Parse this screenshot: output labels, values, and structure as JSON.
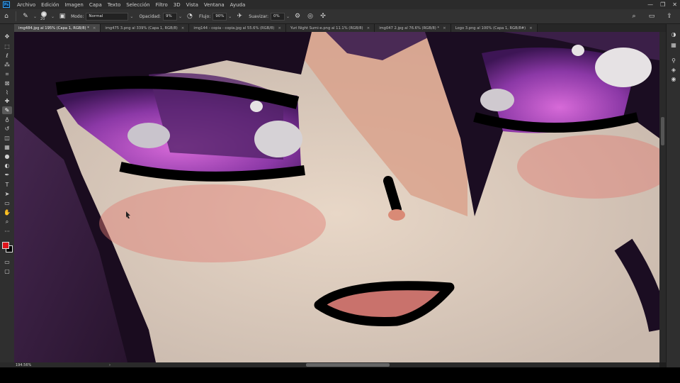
{
  "menu": {
    "logo": "Ps",
    "items": [
      "Archivo",
      "Edición",
      "Imagen",
      "Capa",
      "Texto",
      "Selección",
      "Filtro",
      "3D",
      "Vista",
      "Ventana",
      "Ayuda"
    ],
    "window_controls": [
      "—",
      "❐",
      "✕"
    ]
  },
  "options": {
    "brush_size": "20",
    "mode_label": "Modo:",
    "mode_value": "Normal",
    "opacity_label": "Opacidad:",
    "opacity_value": "9%",
    "flow_label": "Flujo:",
    "flow_value": "90%",
    "smoothing_label": "Suavizar:",
    "smoothing_value": "0%"
  },
  "tabs": [
    {
      "label": "img484.jpg al 195% (Capa 1, RGB/8) *",
      "active": true
    },
    {
      "label": "img475 3.png al 339% (Capa 1, RGB/8)",
      "active": false
    },
    {
      "label": "img144 - copia - copia.jpg al 55.6% (RGB/8)",
      "active": false
    },
    {
      "label": "Yuri Night Sumi-e.png al 11.1% (RGB/8)",
      "active": false
    },
    {
      "label": "img047 2.jpg al 76.6% (RGB/8) *",
      "active": false
    },
    {
      "label": "Logo 3.png al 100% (Capa 1, RGB/8#)",
      "active": false
    }
  ],
  "tools": [
    {
      "name": "move-tool",
      "glyph": "✥"
    },
    {
      "name": "marquee-tool",
      "glyph": "⬚"
    },
    {
      "name": "lasso-tool",
      "glyph": "ℓ"
    },
    {
      "name": "magic-wand-tool",
      "glyph": "⁂"
    },
    {
      "name": "crop-tool",
      "glyph": "⌗"
    },
    {
      "name": "frame-tool",
      "glyph": "⊠"
    },
    {
      "name": "eyedropper-tool",
      "glyph": "⌇"
    },
    {
      "name": "healing-brush-tool",
      "glyph": "✚"
    },
    {
      "name": "brush-tool",
      "glyph": "✎",
      "active": true
    },
    {
      "name": "clone-stamp-tool",
      "glyph": "♁"
    },
    {
      "name": "history-brush-tool",
      "glyph": "↺"
    },
    {
      "name": "eraser-tool",
      "glyph": "◫"
    },
    {
      "name": "gradient-tool",
      "glyph": "▦"
    },
    {
      "name": "blur-tool",
      "glyph": "●"
    },
    {
      "name": "dodge-tool",
      "glyph": "◐"
    },
    {
      "name": "pen-tool",
      "glyph": "✒"
    },
    {
      "name": "type-tool",
      "glyph": "T"
    },
    {
      "name": "path-selection-tool",
      "glyph": "➤"
    },
    {
      "name": "rectangle-tool",
      "glyph": "▭"
    },
    {
      "name": "hand-tool",
      "glyph": "✋"
    },
    {
      "name": "zoom-tool",
      "glyph": "⌕"
    },
    {
      "name": "more-tools",
      "glyph": "···"
    }
  ],
  "status": {
    "zoom": "194.56%",
    "arrow": "›"
  },
  "colors": {
    "foreground": "#e0141c",
    "background": "#000000",
    "ui_dark": "#2b2b2b"
  }
}
